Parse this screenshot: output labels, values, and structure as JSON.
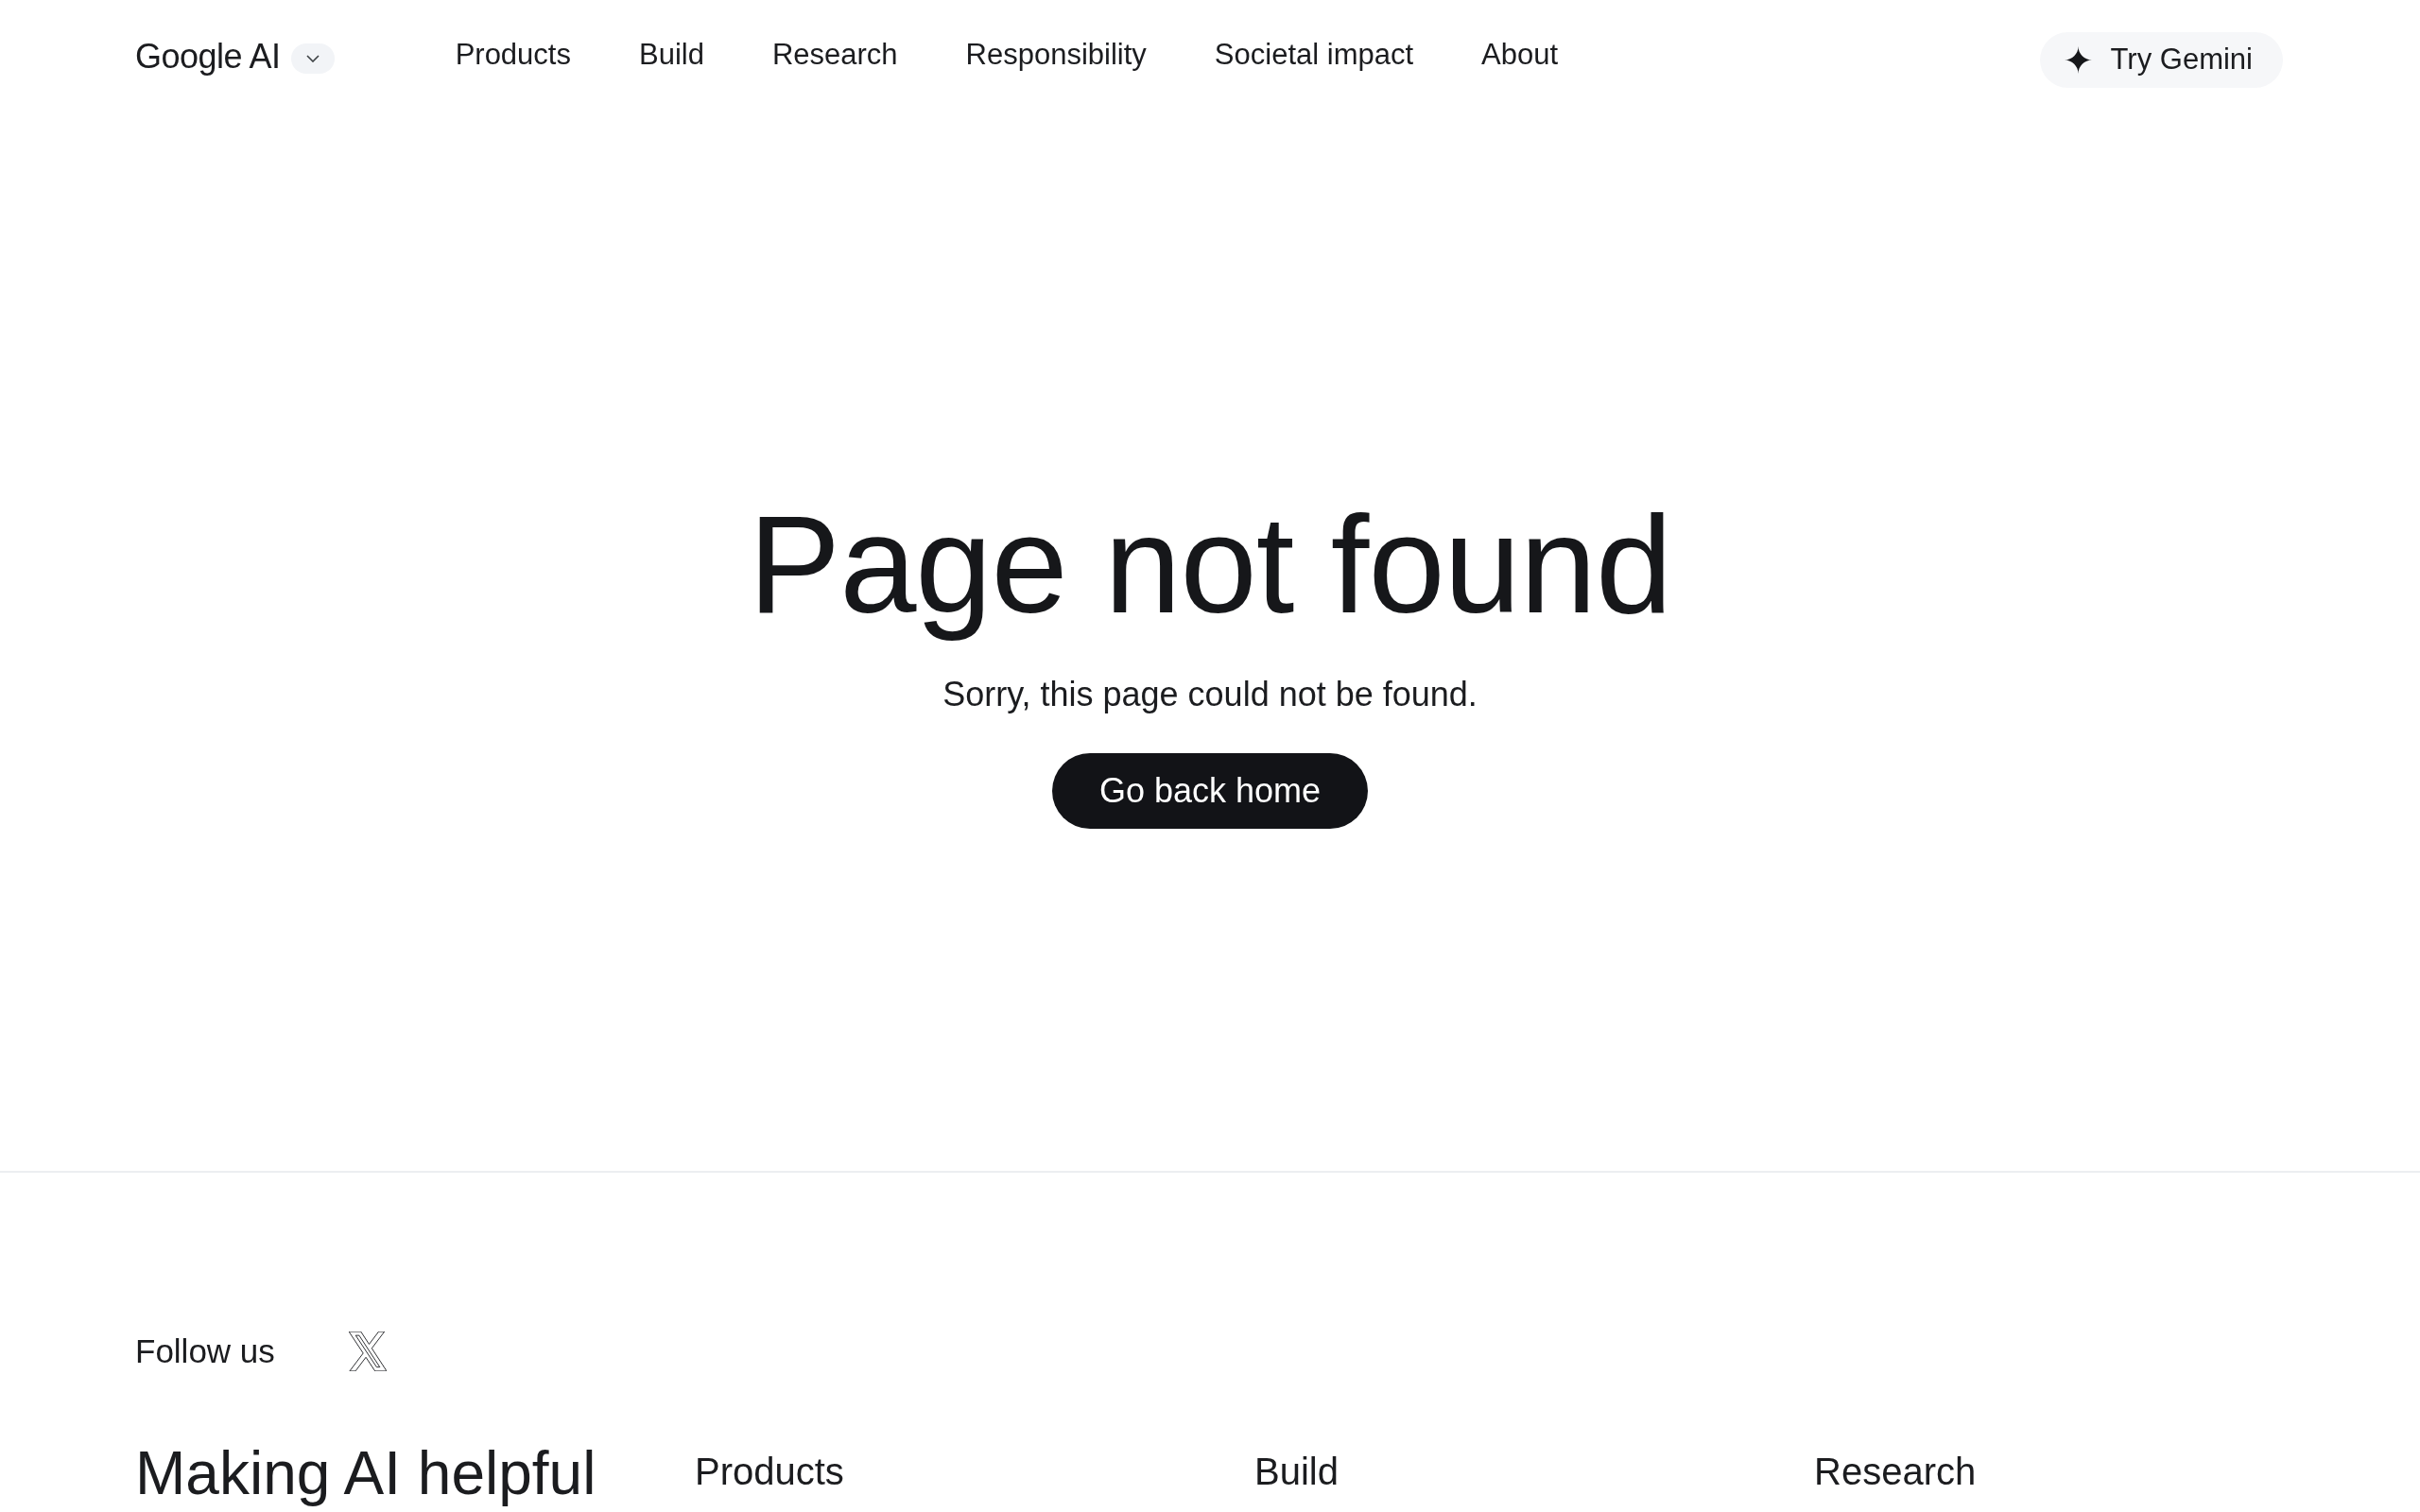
{
  "header": {
    "logo": "Google AI",
    "nav": [
      "Products",
      "Build",
      "Research",
      "Responsibility",
      "Societal impact",
      "About"
    ],
    "cta": "Try Gemini"
  },
  "main": {
    "title": "Page not found",
    "message": "Sorry, this page could not be found.",
    "button": "Go back home"
  },
  "footer": {
    "follow_label": "Follow us",
    "tagline": "Making AI helpful",
    "columns": [
      "Products",
      "Build",
      "Research"
    ]
  }
}
